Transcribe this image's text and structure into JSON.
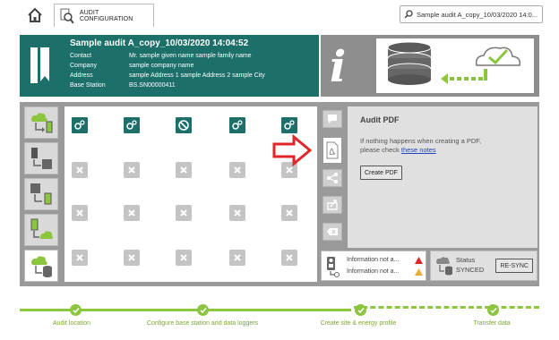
{
  "topbar": {
    "tab_label": "AUDIT CONFIGURATION",
    "search_value": "Sample audit A_copy_10/03/2020 14:0..."
  },
  "header": {
    "title": "Sample audit A_copy_10/03/2020 14:04:52",
    "rows": [
      {
        "key": "Contact",
        "value": "Mr. sample given name sample family name"
      },
      {
        "key": "Company",
        "value": "sample company name"
      },
      {
        "key": "Address",
        "value": "sample Address 1 sample Address 2 sample City"
      },
      {
        "key": "Base Station",
        "value": "BS.SN00000411"
      }
    ]
  },
  "info_panel": {
    "letter": "i"
  },
  "pdf": {
    "title": "Audit PDF",
    "text_1": "If nothing happens when creating a PDF,",
    "text_2": "please check ",
    "link": "these notes",
    "button": "Create PDF"
  },
  "status": {
    "info_1": "Information not a...",
    "info_2": "Information not a...",
    "status_label": "Status",
    "status_value": "SYNCED",
    "resync": "RE-SYNC"
  },
  "steps": [
    {
      "label": "Audit location"
    },
    {
      "label": "Configure base station and data loggers"
    },
    {
      "label": "Create site & energy profile"
    },
    {
      "label": "Transfer data"
    }
  ],
  "colors": {
    "teal": "#1d6f6a",
    "green": "#8cc63f",
    "gray_panel": "#9a9a9a",
    "red_arrow": "#e0262a"
  }
}
